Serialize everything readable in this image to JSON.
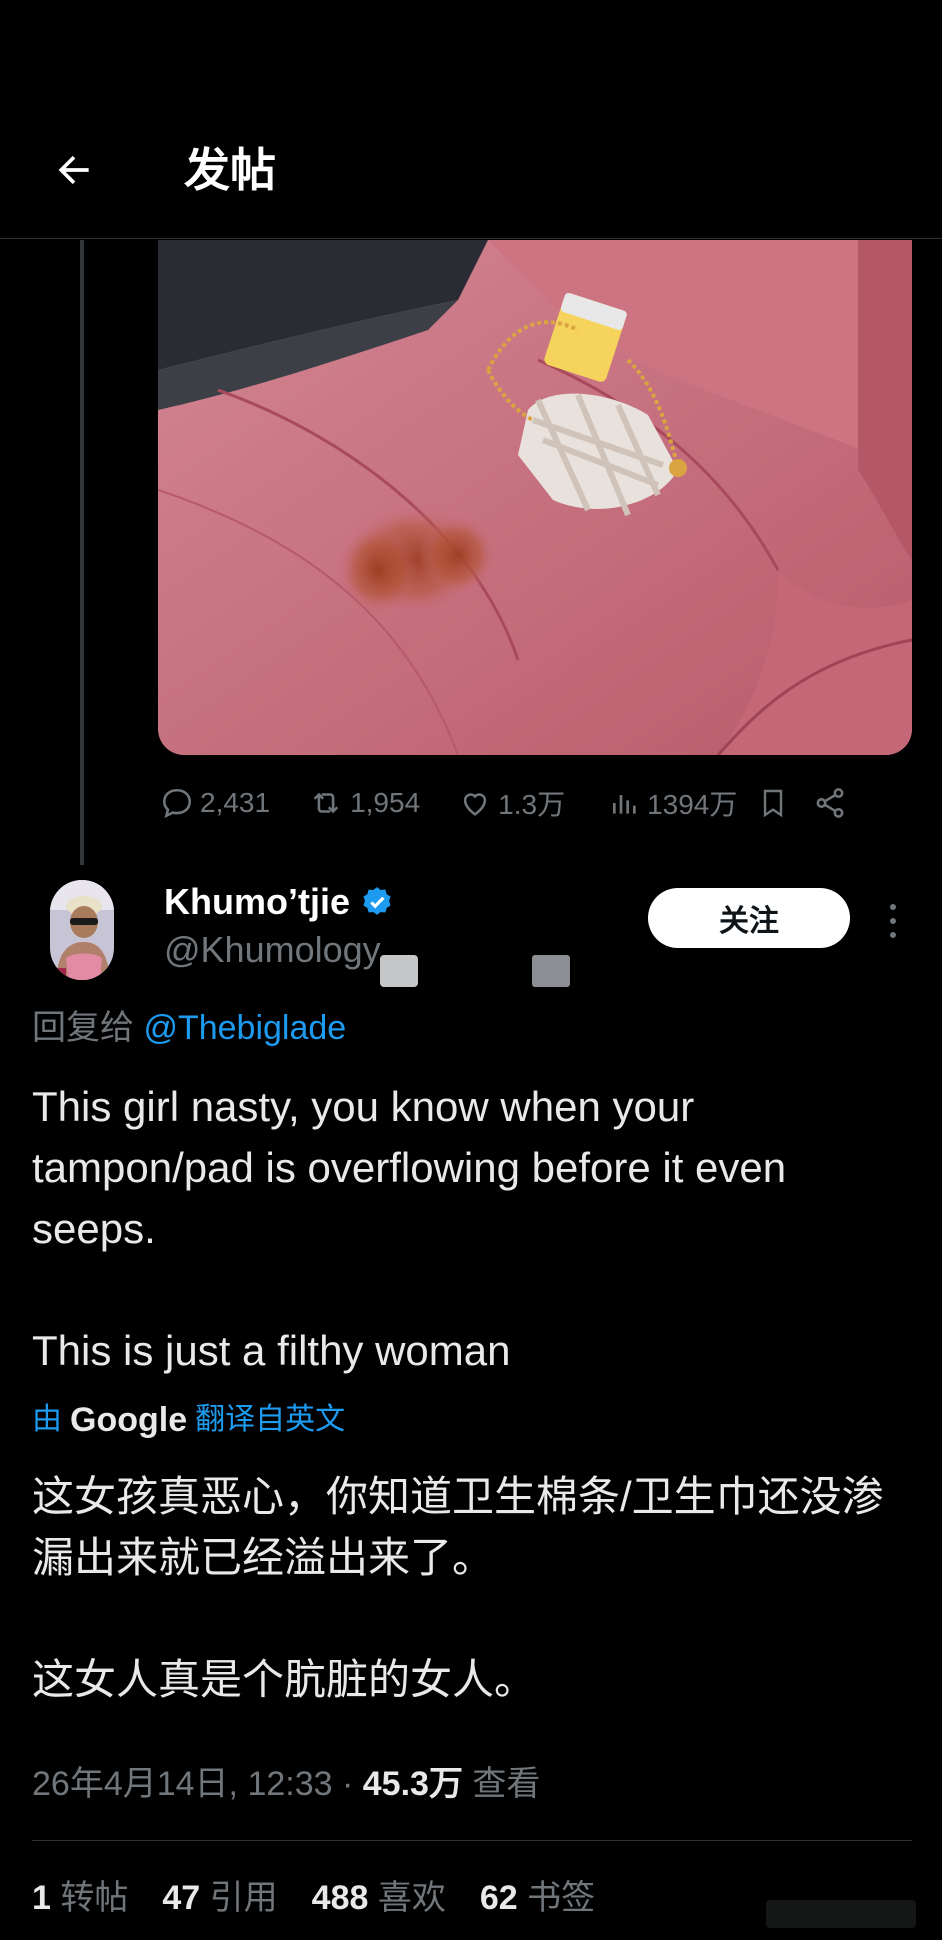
{
  "header": {
    "title": "发帖"
  },
  "post_stats": {
    "replies": "2,431",
    "reposts": "1,954",
    "likes": "1.3万",
    "views": "1394万"
  },
  "reply": {
    "display_name": "Khumo’tjie",
    "handle": "@Khumology",
    "follow_label": "关注",
    "reply_prefix": "回复给",
    "reply_to": "@Thebiglade",
    "text_lines": [
      "This girl nasty, you know when your tampon/pad is overflowing before it even seeps.",
      "This is just a filthy woman"
    ],
    "translate": {
      "prefix": "由",
      "brand": "Google",
      "suffix": "翻译自英文"
    },
    "translated_lines": [
      "这女孩真恶心，你知道卫生棉条/卫生巾还没渗漏出来就已经溢出来了。",
      "这女人真是个肮脏的女人。"
    ],
    "timestamp": "26年4月14日, 12:33",
    "separator": "·",
    "views": "45.3万",
    "views_label": "查看"
  },
  "engagement": {
    "reposts": "1",
    "reposts_label": "转帖",
    "quotes": "47",
    "quotes_label": "引用",
    "likes": "488",
    "likes_label": "喜欢",
    "bookmarks": "62",
    "bookmarks_label": "书签"
  },
  "colors": {
    "background": "#000000",
    "accent": "#1d9bf0",
    "muted": "#71767b",
    "verified": "#1d9bf0",
    "seat": "#c86e7c"
  }
}
